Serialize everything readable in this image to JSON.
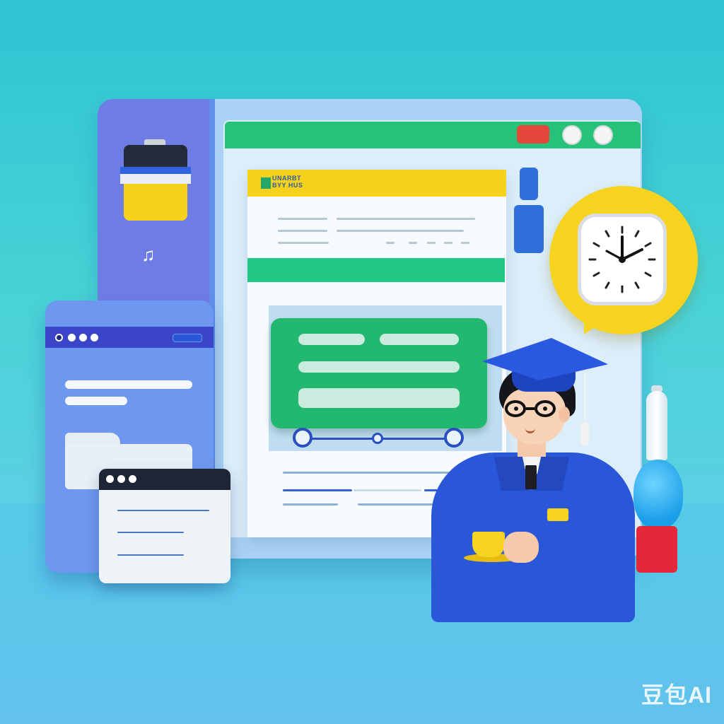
{
  "document": {
    "header_logo_text": "UNARBT BYY HUS"
  },
  "sidebar": {
    "music_icon": "♫"
  },
  "watermark": {
    "text": "豆包AI"
  },
  "colors": {
    "background": "#2ec4d4",
    "main_window": "#a9d2f4",
    "sidebar": "#6e7de6",
    "titlebar": "#26c27a",
    "doc_header": "#f6d21c",
    "accent_green": "#22b870",
    "close_button": "#e4473c",
    "gown": "#2a56d8",
    "clock_bubble": "#f5d31f"
  },
  "icons": [
    "sd-card-icon",
    "music-note-icon",
    "folder-icon",
    "clock-icon",
    "graduation-cap-icon",
    "coffee-cup-icon",
    "lamp-icon"
  ]
}
